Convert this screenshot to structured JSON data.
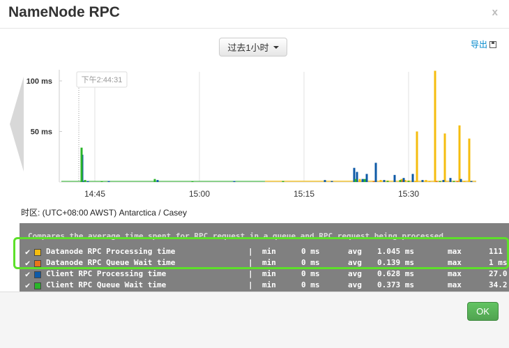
{
  "dialog": {
    "title": "NameNode RPC",
    "close_label": "x"
  },
  "toolbar": {
    "range_label": "过去1小时",
    "export_label": "导出"
  },
  "chart_data": {
    "type": "bar",
    "title": "",
    "xlabel": "",
    "ylabel": "",
    "x_ticks": [
      "14:45",
      "15:00",
      "15:15",
      "15:30"
    ],
    "y_ticks": [
      "50 ms",
      "100 ms"
    ],
    "ylim": [
      0,
      115
    ],
    "hover_time": "下午2:44:31",
    "series": [
      {
        "name": "Datanode RPC Processing time",
        "color": "#f5bd0f",
        "points": [
          [
            38,
            3
          ],
          [
            41,
            2
          ],
          [
            42,
            1.5
          ],
          [
            44,
            3
          ],
          [
            44.5,
            2
          ],
          [
            45,
            1.5
          ],
          [
            46,
            0.5
          ],
          [
            46.2,
            50
          ],
          [
            47,
            0.5
          ],
          [
            47.5,
            2
          ],
          [
            48,
            0.5
          ],
          [
            48.8,
            110
          ],
          [
            49,
            1
          ],
          [
            49.5,
            1
          ],
          [
            50.2,
            48
          ],
          [
            51,
            1
          ],
          [
            51.5,
            1
          ],
          [
            52.3,
            56
          ],
          [
            53,
            1
          ],
          [
            53.7,
            43
          ]
        ]
      },
      {
        "name": "Datanode RPC Queue Wait time",
        "color": "#e8751a",
        "points": [
          [
            40,
            1
          ],
          [
            44,
            1.5
          ],
          [
            49,
            1
          ],
          [
            52,
            1
          ]
        ]
      },
      {
        "name": "Client RPC Processing time",
        "color": "#0e5aa7",
        "points": [
          [
            -1.8,
            27
          ],
          [
            -1.5,
            1
          ],
          [
            -1,
            1
          ],
          [
            2,
            1
          ],
          [
            9,
            2
          ],
          [
            20,
            1
          ],
          [
            33,
            2
          ],
          [
            34,
            1
          ],
          [
            37.2,
            14
          ],
          [
            37.6,
            10
          ],
          [
            38.4,
            3
          ],
          [
            39,
            8
          ],
          [
            40.3,
            19
          ],
          [
            41.5,
            2
          ],
          [
            43,
            7
          ],
          [
            44.3,
            4
          ],
          [
            45.6,
            8
          ],
          [
            47,
            2
          ],
          [
            50,
            2
          ],
          [
            51,
            4
          ],
          [
            52.5,
            3
          ],
          [
            54,
            1
          ]
        ]
      },
      {
        "name": "Client RPC Queue Wait time",
        "color": "#2ab52a",
        "points": [
          [
            -1.9,
            34
          ],
          [
            -1.4,
            2
          ],
          [
            1,
            1
          ],
          [
            8.6,
            3
          ],
          [
            14,
            1
          ],
          [
            27,
            1
          ],
          [
            37.4,
            3
          ],
          [
            38.7,
            3
          ],
          [
            42,
            1
          ],
          [
            43.8,
            2
          ],
          [
            45,
            1
          ],
          [
            49.5,
            1
          ],
          [
            51.5,
            1
          ]
        ]
      }
    ]
  },
  "timezone": "时区: (UTC+08:00 AWST) Antarctica / Casey",
  "legend": {
    "description": "Compares the average time spent for RPC request in a queue and RPC request being processed.",
    "rows": [
      {
        "check": "✔",
        "name": "Datanode RPC Processing time",
        "color": "#f5bd0f",
        "min_label": "min",
        "min": "0 ms",
        "avg_label": "avg",
        "avg": "1.045 ms",
        "max_label": "max",
        "max": "111"
      },
      {
        "check": "✔",
        "name": "Datanode RPC Queue Wait time",
        "color": "#e8751a",
        "min_label": "min",
        "min": "0 ms",
        "avg_label": "avg",
        "avg": "0.139 ms",
        "max_label": "max",
        "max": "1 ms"
      },
      {
        "check": "✔",
        "name": "Client RPC Processing time",
        "color": "#0e5aa7",
        "min_label": "min",
        "min": "0 ms",
        "avg_label": "avg",
        "avg": "0.628 ms",
        "max_label": "max",
        "max": "27.0"
      },
      {
        "check": "✔",
        "name": "Client RPC Queue Wait time",
        "color": "#2ab52a",
        "min_label": "min",
        "min": "0 ms",
        "avg_label": "avg",
        "avg": "0.373 ms",
        "max_label": "max",
        "max": "34.2"
      }
    ]
  },
  "footer": {
    "ok_label": "OK"
  }
}
